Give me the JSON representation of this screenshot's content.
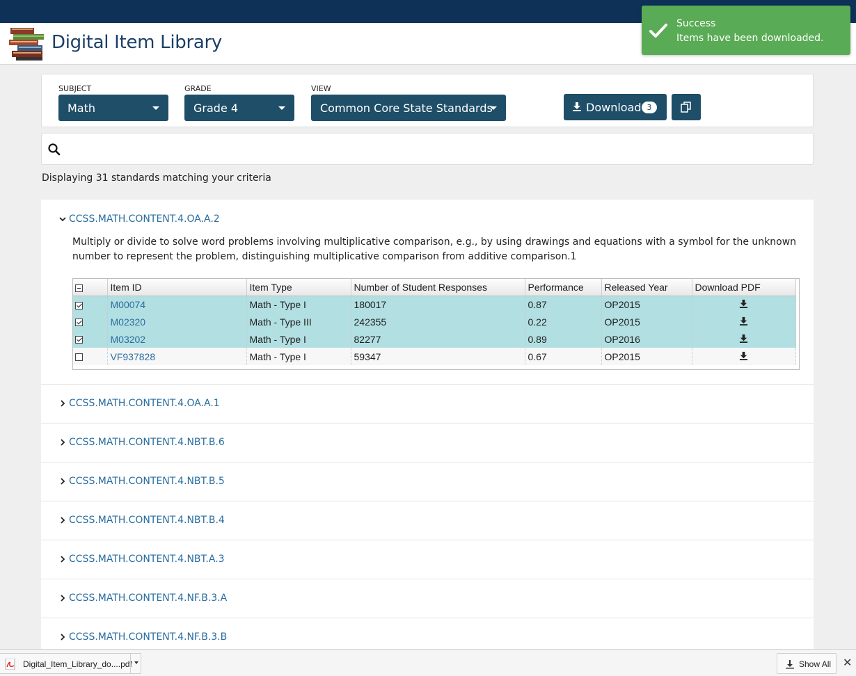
{
  "header": {
    "app_title": "Digital Item Library"
  },
  "toast": {
    "title": "Success",
    "message": "Items have been downloaded."
  },
  "filters": {
    "subject": {
      "label": "SUBJECT",
      "value": "Math"
    },
    "grade": {
      "label": "GRADE",
      "value": "Grade 4"
    },
    "view": {
      "label": "VIEW",
      "value": "Common Core State Standards"
    },
    "download_label": "Download",
    "download_count": "3"
  },
  "search": {
    "value": "",
    "placeholder": ""
  },
  "results_text": "Displaying 31 standards matching your criteria",
  "expanded_standard": {
    "code": "CCSS.MATH.CONTENT.4.OA.A.2",
    "description": "Multiply or divide to solve word problems involving multiplicative comparison, e.g., by using drawings and equations with a symbol for the unknown number to represent the problem, distinguishing multiplicative comparison from additive comparison.1",
    "columns": [
      "Item ID",
      "Item Type",
      "Number of Student Responses",
      "Performance",
      "Released Year",
      "Download PDF"
    ],
    "rows": [
      {
        "checked": true,
        "item_id": "M00074",
        "item_type": "Math - Type I",
        "responses": "180017",
        "performance": "0.87",
        "released": "OP2015"
      },
      {
        "checked": true,
        "item_id": "M02320",
        "item_type": "Math - Type III",
        "responses": "242355",
        "performance": "0.22",
        "released": "OP2015"
      },
      {
        "checked": true,
        "item_id": "M03202",
        "item_type": "Math - Type I",
        "responses": "82277",
        "performance": "0.89",
        "released": "OP2016"
      },
      {
        "checked": false,
        "item_id": "VF937828",
        "item_type": "Math - Type I",
        "responses": "59347",
        "performance": "0.67",
        "released": "OP2015"
      }
    ]
  },
  "collapsed_standards": [
    "CCSS.MATH.CONTENT.4.OA.A.1",
    "CCSS.MATH.CONTENT.4.NBT.B.6",
    "CCSS.MATH.CONTENT.4.NBT.B.5",
    "CCSS.MATH.CONTENT.4.NBT.B.4",
    "CCSS.MATH.CONTENT.4.NBT.A.3",
    "CCSS.MATH.CONTENT.4.NF.B.3.A",
    "CCSS.MATH.CONTENT.4.NF.B.3.B"
  ],
  "download_bar": {
    "file_name": "Digital_Item_Library_do....pdf",
    "show_all_label": "Show All",
    "close_label": "✕"
  },
  "colors": {
    "navy": "#0e3158",
    "button": "#1e4e68",
    "link": "#2a6ea0",
    "success": "#5aab55",
    "row_selected": "#b2dfe2"
  }
}
